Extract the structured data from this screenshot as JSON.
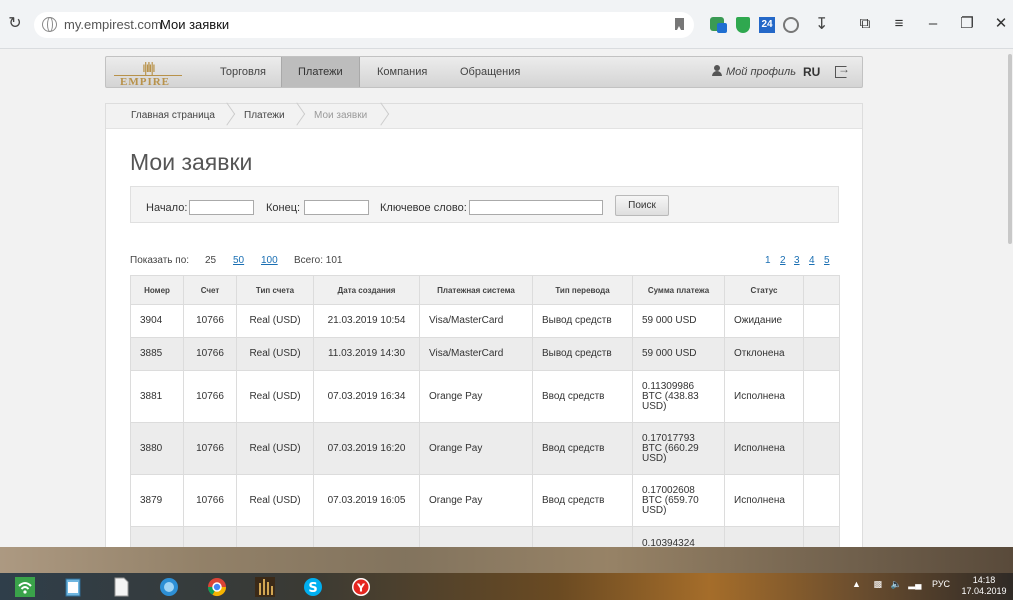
{
  "browser": {
    "url_domain": "my.empirest.com",
    "tab_title": "Мои заявки",
    "ext_badge": "24"
  },
  "site": {
    "logo_text": "EMPIRE",
    "nav": [
      "Торговля",
      "Платежи",
      "Компания",
      "Обращения"
    ],
    "active_nav": "Платежи",
    "profile_label": "Мой профиль",
    "lang": "RU"
  },
  "breadcrumbs": [
    "Главная страница",
    "Платежи",
    "Мои заявки"
  ],
  "page_title": "Мои заявки",
  "filter": {
    "start_label": "Начало:",
    "start_value": "",
    "end_label": "Конец:",
    "end_value": "",
    "keyword_label": "Ключевое слово:",
    "keyword_value": "",
    "search_button": "Поиск"
  },
  "pager": {
    "show_label": "Показать по:",
    "sizes": [
      "25",
      "50",
      "100"
    ],
    "total_label": "Всего: 101",
    "pages": [
      "1",
      "2",
      "3",
      "4",
      "5"
    ]
  },
  "table": {
    "headers": [
      "Номер",
      "Счет",
      "Тип счета",
      "Дата создания",
      "Платежная система",
      "Тип перевода",
      "Сумма платежа",
      "Статус",
      ""
    ],
    "rows": [
      [
        "3904",
        "10766",
        "Real (USD)",
        "21.03.2019 10:54",
        "Visa/MasterCard",
        "Вывод средств",
        "59 000 USD",
        "Ожидание"
      ],
      [
        "3885",
        "10766",
        "Real (USD)",
        "11.03.2019 14:30",
        "Visa/MasterCard",
        "Вывод средств",
        "59 000 USD",
        "Отклонена"
      ],
      [
        "3881",
        "10766",
        "Real (USD)",
        "07.03.2019 16:34",
        "Orange Pay",
        "Ввод средств",
        "0.11309986 BTC (438.83 USD)",
        "Исполнена"
      ],
      [
        "3880",
        "10766",
        "Real (USD)",
        "07.03.2019 16:20",
        "Orange Pay",
        "Ввод средств",
        "0.17017793 BTC (660.29 USD)",
        "Исполнена"
      ],
      [
        "3879",
        "10766",
        "Real (USD)",
        "07.03.2019 16:05",
        "Orange Pay",
        "Ввод средств",
        "0.17002608 BTC (659.70 USD)",
        "Исполнена"
      ],
      [
        "",
        "",
        "",
        "",
        "",
        "",
        "0.10394324",
        ""
      ]
    ]
  },
  "taskbar": {
    "lang": "РУС",
    "time": "14:18",
    "date": "17.04.2019"
  },
  "colors": {
    "link": "#1a6fb3",
    "logo_gold": "#b8924a",
    "nav_active": "#bdbdbd"
  }
}
